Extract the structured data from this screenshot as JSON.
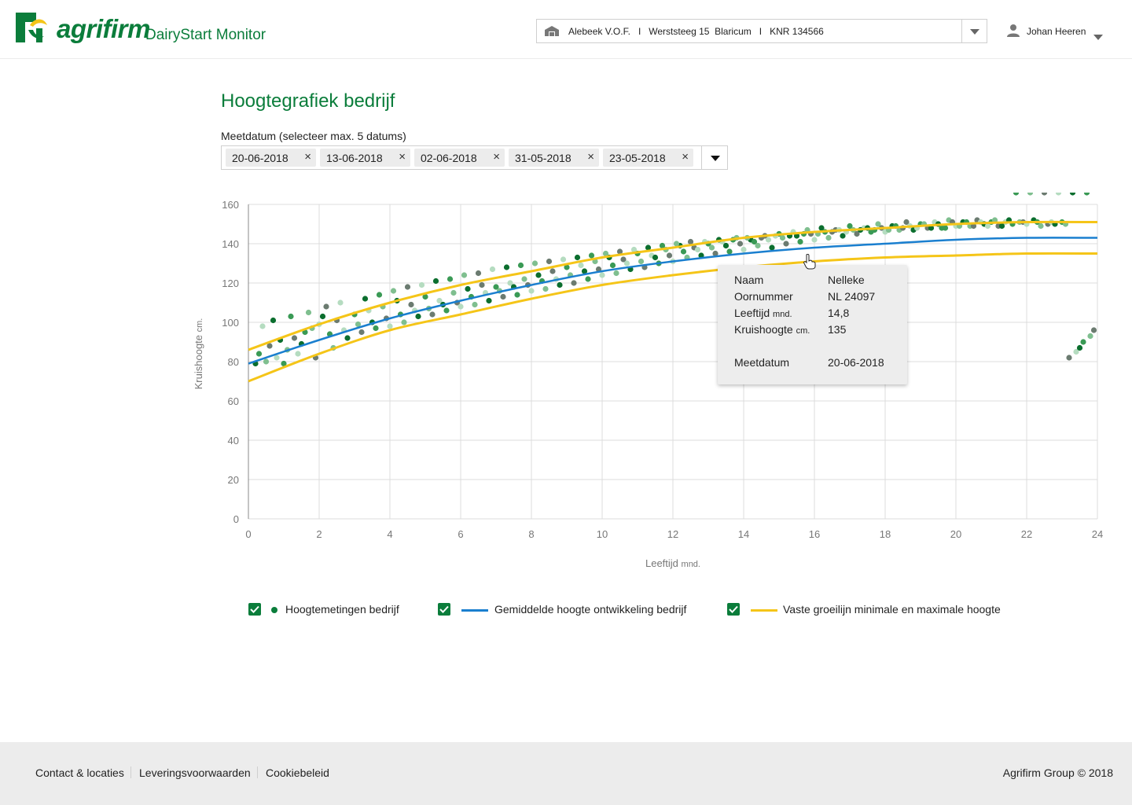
{
  "header": {
    "logo_text": "agrifirm",
    "app_title": "DairyStart Monitor",
    "farm_selector": "Alebeek V.O.F.   I   Werststeeg 15  Blaricum   I   KNR 134566",
    "farm_icon": "barn-icon",
    "user_name": "Johan Heeren",
    "user_icon": "person-icon"
  },
  "main": {
    "title": "Hoogtegrafiek bedrijf",
    "date_label": "Meetdatum (selecteer max. 5 datums)",
    "dates": [
      "20-06-2018",
      "13-06-2018",
      "02-06-2018",
      "31-05-2018",
      "23-05-2018"
    ],
    "chip_remove_glyph": "×"
  },
  "tooltip": {
    "rows": [
      {
        "label": "Naam",
        "unit": "",
        "value": "Nelleke"
      },
      {
        "label": "Oornummer",
        "unit": "",
        "value": "NL 24097"
      },
      {
        "label": "Leeftijd",
        "unit": "mnd.",
        "value": "14,8"
      },
      {
        "label": "Kruishoogte",
        "unit": "cm.",
        "value": "135"
      },
      {
        "label": "Meetdatum",
        "unit": "",
        "value": "20-06-2018"
      }
    ]
  },
  "legend": {
    "items": [
      {
        "label": "Hoogtemetingen bedrijf",
        "checked": true
      },
      {
        "label": "Gemiddelde hoogte ontwikkeling bedrijf",
        "checked": true
      },
      {
        "label": "Vaste groeilijn minimale en maximale hoogte",
        "checked": true
      }
    ]
  },
  "footer": {
    "links": [
      "Contact & locaties",
      "Leveringsvoorwaarden",
      "Cookiebeleid"
    ],
    "copyright": "Agrifirm Group © 2018"
  },
  "colors": {
    "brand_green": "#0b7d3b",
    "mean_line": "#1a7fcf",
    "band_lines": "#f5c518",
    "point_colors": [
      "#0b6e2e",
      "#3a9a55",
      "#7fbf8f",
      "#6b7b70",
      "#b5dcc0"
    ]
  },
  "chart_data": {
    "type": "scatter",
    "xlabel": "Leeftijd",
    "xlabel_unit": "mnd.",
    "ylabel": "Kruishoogte",
    "ylabel_unit": "cm.",
    "xlim": [
      0,
      24
    ],
    "ylim": [
      0,
      160
    ],
    "xticks": [
      "0",
      "2",
      "4",
      "6",
      "8",
      "10",
      "12",
      "14",
      "16",
      "18",
      "20",
      "22",
      "24"
    ],
    "yticks": [
      "0",
      "20",
      "40",
      "60",
      "80",
      "100",
      "120",
      "140",
      "160"
    ],
    "grid": true,
    "lines": [
      {
        "role": "mean",
        "x": [
          0,
          2,
          4,
          6,
          8,
          10,
          12,
          14,
          16,
          18,
          20,
          22,
          24
        ],
        "y": [
          79,
          91,
          102,
          111,
          119,
          126,
          131,
          135,
          138,
          140,
          142,
          143,
          143
        ]
      },
      {
        "role": "max",
        "x": [
          0,
          2,
          4,
          6,
          8,
          10,
          12,
          14,
          16,
          18,
          20,
          22,
          24
        ],
        "y": [
          86,
          99,
          110,
          119,
          126,
          133,
          138,
          143,
          146,
          148,
          150,
          151,
          151
        ]
      },
      {
        "role": "min",
        "x": [
          0,
          2,
          4,
          6,
          8,
          10,
          12,
          14,
          16,
          18,
          20,
          22,
          24
        ],
        "y": [
          70,
          84,
          96,
          104,
          112,
          119,
          124,
          128,
          131,
          133,
          134,
          135,
          135
        ]
      }
    ],
    "points": {
      "x": [
        0.2,
        0.3,
        0.5,
        0.6,
        0.8,
        0.9,
        1.0,
        1.1,
        1.3,
        1.4,
        1.5,
        1.6,
        1.8,
        1.9,
        2.0,
        2.1,
        2.3,
        2.4,
        2.5,
        2.7,
        2.8,
        3.0,
        3.1,
        3.2,
        3.4,
        3.5,
        3.6,
        3.8,
        3.9,
        4.0,
        4.2,
        4.3,
        4.4,
        4.6,
        4.7,
        4.8,
        5.0,
        5.1,
        5.2,
        5.4,
        5.5,
        5.6,
        5.8,
        5.9,
        6.0,
        6.2,
        6.3,
        6.4,
        6.6,
        6.7,
        6.8,
        7.0,
        7.1,
        7.2,
        7.4,
        7.5,
        7.6,
        7.8,
        7.9,
        8.0,
        8.2,
        8.3,
        8.4,
        8.6,
        8.7,
        8.8,
        9.0,
        9.1,
        9.2,
        9.4,
        9.5,
        9.6,
        9.8,
        9.9,
        10.0,
        10.2,
        10.3,
        10.4,
        10.6,
        10.7,
        10.8,
        11.0,
        11.1,
        11.2,
        11.4,
        11.5,
        11.6,
        11.8,
        11.9,
        12.0,
        12.2,
        12.3,
        12.4,
        12.6,
        12.7,
        12.8,
        13.0,
        13.1,
        13.2,
        13.4,
        13.5,
        13.6,
        13.8,
        13.9,
        14.0,
        14.2,
        14.3,
        14.4,
        14.6,
        14.7,
        14.8,
        15.0,
        15.1,
        15.2,
        15.4,
        15.5,
        15.6,
        15.8,
        15.9,
        16.0,
        16.2,
        16.3,
        16.4,
        16.6,
        16.7,
        16.8,
        17.0,
        17.1,
        17.2,
        17.4,
        17.5,
        17.6,
        17.8,
        17.9,
        18.0,
        18.2,
        18.3,
        18.4,
        18.6,
        18.7,
        18.8,
        19.0,
        19.1,
        19.2,
        19.4,
        19.5,
        19.6,
        19.8,
        19.9,
        20.0,
        20.2,
        20.3,
        20.4,
        20.6,
        20.7,
        20.8,
        21.0,
        21.1,
        21.2,
        21.4,
        21.5,
        21.6,
        21.8,
        21.9,
        22.0,
        22.2,
        22.3,
        22.4,
        22.6,
        22.7,
        22.8,
        23.0,
        23.1,
        23.2,
        23.4,
        23.5,
        23.6,
        23.8,
        23.9,
        0.4,
        0.7,
        1.2,
        1.7,
        2.2,
        2.6,
        3.3,
        3.7,
        4.1,
        4.5,
        4.9,
        5.3,
        5.7,
        6.1,
        6.5,
        6.9,
        7.3,
        7.7,
        8.1,
        8.5,
        8.9,
        9.3,
        9.7,
        10.1,
        10.5,
        10.9,
        11.3,
        11.7,
        12.1,
        12.5,
        12.9,
        13.3,
        13.7,
        14.1,
        14.5,
        14.9,
        15.3,
        15.7,
        16.1,
        16.5,
        16.9,
        17.3,
        17.7,
        18.1,
        18.5,
        18.9,
        19.3,
        19.7,
        20.1,
        20.5,
        20.9,
        21.3,
        21.7,
        22.1,
        22.5,
        22.9,
        23.3,
        23.7
      ],
      "y": [
        79,
        84,
        80,
        88,
        82,
        91,
        79,
        86,
        92,
        84,
        89,
        95,
        97,
        82,
        99,
        103,
        94,
        87,
        101,
        96,
        92,
        104,
        99,
        95,
        106,
        100,
        97,
        108,
        102,
        98,
        111,
        104,
        100,
        109,
        106,
        103,
        113,
        107,
        104,
        111,
        109,
        106,
        115,
        110,
        108,
        117,
        113,
        109,
        119,
        115,
        111,
        118,
        116,
        113,
        120,
        118,
        114,
        122,
        119,
        116,
        124,
        121,
        117,
        126,
        122,
        119,
        128,
        124,
        120,
        129,
        126,
        122,
        131,
        127,
        124,
        133,
        129,
        125,
        132,
        130,
        127,
        135,
        131,
        128,
        134,
        133,
        130,
        137,
        134,
        131,
        139,
        136,
        133,
        138,
        137,
        134,
        140,
        138,
        135,
        141,
        139,
        136,
        143,
        140,
        137,
        142,
        141,
        139,
        144,
        142,
        138,
        145,
        143,
        140,
        146,
        144,
        141,
        147,
        145,
        142,
        148,
        146,
        143,
        147,
        147,
        144,
        149,
        147,
        145,
        148,
        148,
        146,
        150,
        148,
        146,
        149,
        149,
        147,
        151,
        149,
        147,
        150,
        150,
        148,
        151,
        150,
        148,
        152,
        151,
        149,
        151,
        151,
        149,
        152,
        151,
        150,
        151,
        152,
        149,
        151,
        152,
        150,
        151,
        151,
        150,
        152,
        151,
        149,
        150,
        151,
        150,
        151,
        150,
        82,
        85,
        87,
        90,
        93,
        96,
        98,
        101,
        103,
        105,
        108,
        110,
        112,
        114,
        116,
        118,
        119,
        121,
        122,
        124,
        125,
        127,
        128,
        129,
        130,
        131,
        132,
        133,
        134,
        135,
        136,
        137,
        138,
        139,
        140,
        141,
        141,
        142,
        142,
        143,
        143,
        144,
        144,
        145,
        145,
        146,
        146,
        147,
        147,
        147,
        148,
        148,
        148,
        148,
        149,
        149,
        149,
        149
      ],
      "colors": [
        0,
        1,
        2,
        3,
        4,
        0,
        1,
        2,
        3,
        4,
        0,
        1,
        2,
        3,
        4,
        0,
        1,
        2,
        3,
        4,
        0,
        1,
        2,
        3,
        4,
        0,
        1,
        2,
        3,
        4,
        0,
        1,
        2,
        3,
        4,
        0,
        1,
        2,
        3,
        4,
        0,
        1,
        2,
        3,
        4,
        0,
        1,
        2,
        3,
        4,
        0,
        1,
        2,
        3,
        4,
        0,
        1,
        2,
        3,
        4,
        0,
        1,
        2,
        3,
        4,
        0,
        1,
        2,
        3,
        4,
        0,
        1,
        2,
        3,
        4,
        0,
        1,
        2,
        3,
        4,
        0,
        1,
        2,
        3,
        4,
        0,
        1,
        2,
        3,
        4,
        0,
        1,
        2,
        3,
        4,
        0,
        1,
        2,
        3,
        4,
        0,
        1,
        2,
        3,
        4,
        0,
        1,
        2,
        3,
        4,
        0,
        1,
        2,
        3,
        4,
        0,
        1,
        2,
        3,
        4,
        0,
        1,
        2,
        3,
        4,
        0,
        1,
        2,
        3,
        4,
        0,
        1,
        2,
        3,
        4,
        0,
        1,
        2,
        3,
        4,
        0,
        1,
        2,
        3,
        4,
        0,
        1,
        2,
        3,
        4,
        0,
        1,
        2,
        3,
        4,
        0,
        1,
        2,
        3,
        4,
        0,
        1,
        2,
        3,
        4,
        0,
        1,
        2,
        3,
        4,
        0,
        1,
        2,
        3,
        4,
        0,
        1,
        2,
        3,
        4,
        0,
        1,
        2,
        3,
        4,
        0,
        1,
        2,
        3,
        4,
        0,
        1,
        2,
        3,
        4,
        0,
        1,
        2,
        3,
        4,
        0,
        1,
        2,
        3,
        4,
        0,
        1,
        2,
        3,
        4,
        0,
        1,
        2,
        3,
        4,
        0,
        1,
        2,
        3,
        4,
        0,
        1,
        2,
        3,
        4,
        0,
        1,
        2,
        3,
        4,
        0,
        1,
        2,
        3,
        4,
        0,
        1,
        2,
        3,
        4,
        0,
        1,
        2,
        3,
        4,
        0,
        1,
        2,
        3,
        4
      ]
    }
  }
}
